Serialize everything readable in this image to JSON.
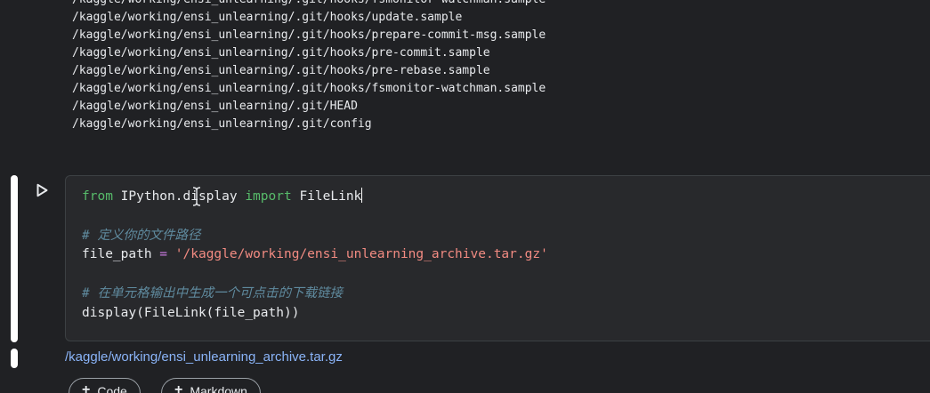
{
  "output": {
    "lines": [
      "/kaggle/working/ensi_unlearning/.git/hooks/fsmonitor-watchman.sample",
      "/kaggle/working/ensi_unlearning/.git/hooks/update.sample",
      "/kaggle/working/ensi_unlearning/.git/hooks/prepare-commit-msg.sample",
      "/kaggle/working/ensi_unlearning/.git/hooks/pre-commit.sample",
      "/kaggle/working/ensi_unlearning/.git/hooks/pre-rebase.sample",
      "/kaggle/working/ensi_unlearning/.git/hooks/fsmonitor-watchman.sample",
      "/kaggle/working/ensi_unlearning/.git/HEAD",
      "/kaggle/working/ensi_unlearning/.git/config"
    ]
  },
  "cell": {
    "code": {
      "line1": {
        "kw_from": "from",
        "module": " IPython.display ",
        "kw_import": "import",
        "name": " FileLink"
      },
      "comment1": "# 定义你的文件路径",
      "line3": {
        "var": "file_path",
        "op": " = ",
        "str": "'/kaggle/working/ensi_unlearning_archive.tar.gz'"
      },
      "comment2": "# 在单元格输出中生成一个可点击的下载链接",
      "line5": "display(FileLink(file_path))"
    },
    "result_link": "/kaggle/working/ensi_unlearning_archive.tar.gz"
  },
  "toolbar": {
    "add_code_label": "Code",
    "add_markdown_label": "Markdown"
  },
  "icons": {
    "run": "play-icon",
    "plus": "plus-icon",
    "text_cursor": "i-beam-cursor-icon"
  },
  "colors": {
    "background": "#202124",
    "editor_background": "#28292c",
    "keyword": "#57bb6a",
    "operator": "#c678dd",
    "string": "#f28b82",
    "comment": "#5f8a9e",
    "link": "#8ab4f8"
  }
}
